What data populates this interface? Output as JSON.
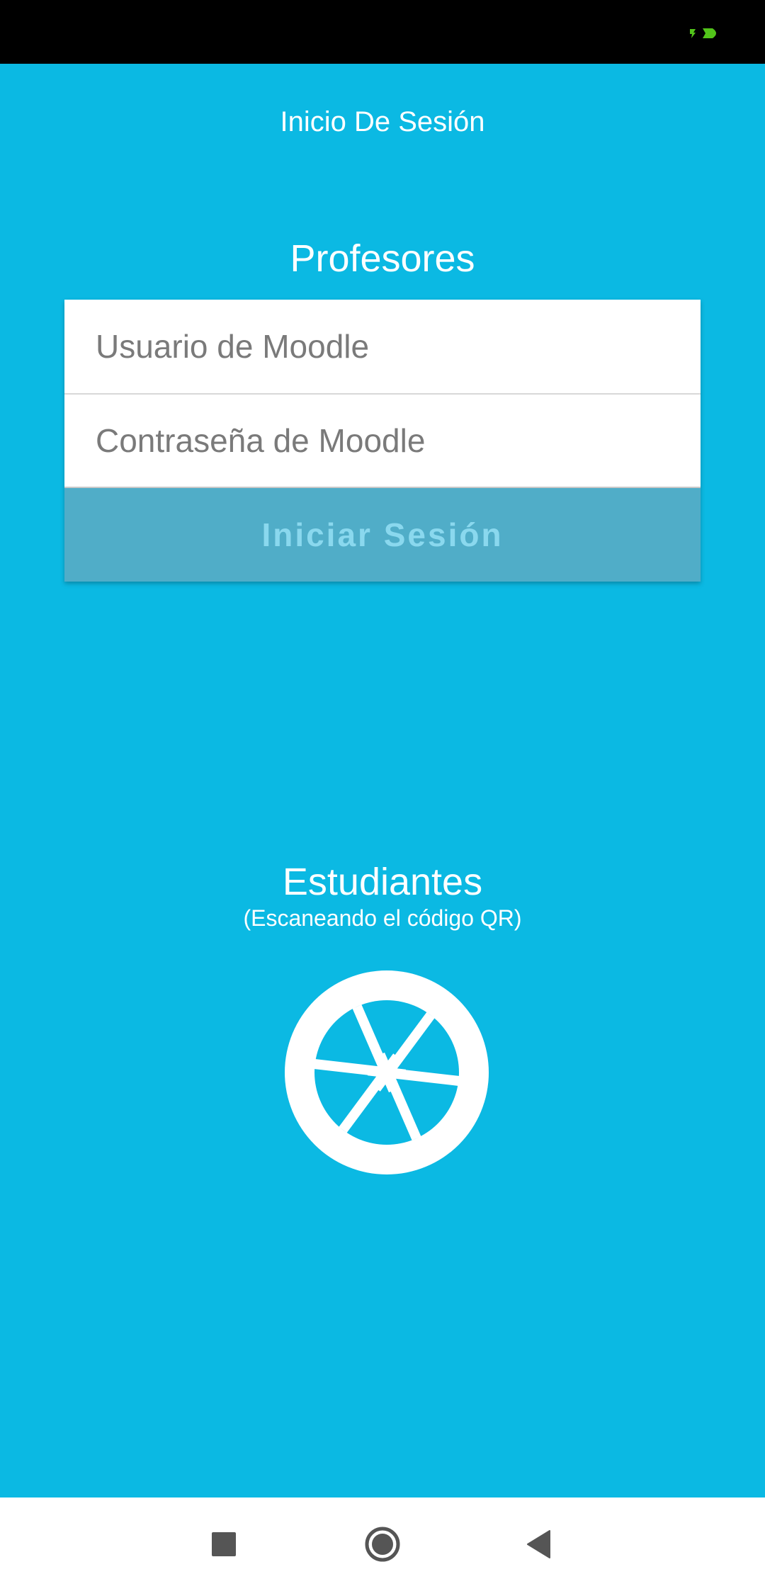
{
  "screen": {
    "title": "Inicio De Sesión"
  },
  "teachers": {
    "title": "Profesores",
    "username_placeholder": "Usuario de Moodle",
    "username_value": "",
    "password_placeholder": "Contraseña de Moodle",
    "password_value": "",
    "login_label": "Iniciar Sesión"
  },
  "students": {
    "title": "Estudiantes",
    "subtitle": "(Escaneando el código QR)",
    "scan_icon": "camera-shutter-icon"
  },
  "nav": {
    "recents_icon": "recents-square-icon",
    "home_icon": "home-circle-icon",
    "back_icon": "back-triangle-icon"
  },
  "colors": {
    "background": "#0bb9e3",
    "button_disabled_bg": "#50adc8",
    "button_disabled_text": "#8ad8ee",
    "status_indicator": "#52c41a"
  }
}
